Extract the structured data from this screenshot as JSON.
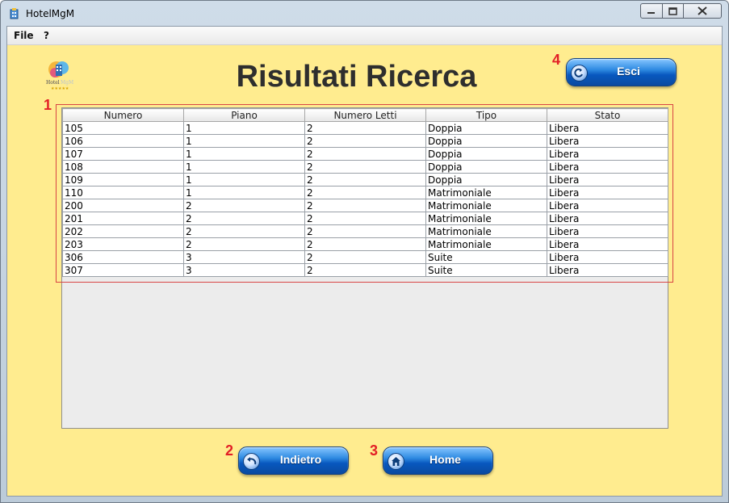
{
  "window": {
    "title": "HotelMgM",
    "controls": {
      "minimize_icon": "minimize-icon",
      "maximize_icon": "maximize-icon",
      "close_icon": "close-icon"
    }
  },
  "menubar": {
    "items": [
      {
        "label": "File"
      },
      {
        "label": "?"
      }
    ]
  },
  "page": {
    "title": "Risultati Ricerca",
    "background": "#ffec8f",
    "logo_text": "Hotel"
  },
  "annotations": [
    "1",
    "2",
    "3",
    "4"
  ],
  "buttons": {
    "exit": {
      "label": "Esci",
      "icon": "exit-arrow-icon"
    },
    "back": {
      "label": "Indietro",
      "icon": "back-arrow-icon"
    },
    "home": {
      "label": "Home",
      "icon": "house-icon"
    }
  },
  "table": {
    "columns": [
      "Numero",
      "Piano",
      "Numero Letti",
      "Tipo",
      "Stato"
    ],
    "rows": [
      [
        "105",
        "1",
        "2",
        "Doppia",
        "Libera"
      ],
      [
        "106",
        "1",
        "2",
        "Doppia",
        "Libera"
      ],
      [
        "107",
        "1",
        "2",
        "Doppia",
        "Libera"
      ],
      [
        "108",
        "1",
        "2",
        "Doppia",
        "Libera"
      ],
      [
        "109",
        "1",
        "2",
        "Doppia",
        "Libera"
      ],
      [
        "110",
        "1",
        "2",
        "Matrimoniale",
        "Libera"
      ],
      [
        "200",
        "2",
        "2",
        "Matrimoniale",
        "Libera"
      ],
      [
        "201",
        "2",
        "2",
        "Matrimoniale",
        "Libera"
      ],
      [
        "202",
        "2",
        "2",
        "Matrimoniale",
        "Libera"
      ],
      [
        "203",
        "2",
        "2",
        "Matrimoniale",
        "Libera"
      ],
      [
        "306",
        "3",
        "2",
        "Suite",
        "Libera"
      ],
      [
        "307",
        "3",
        "2",
        "Suite",
        "Libera"
      ]
    ]
  }
}
